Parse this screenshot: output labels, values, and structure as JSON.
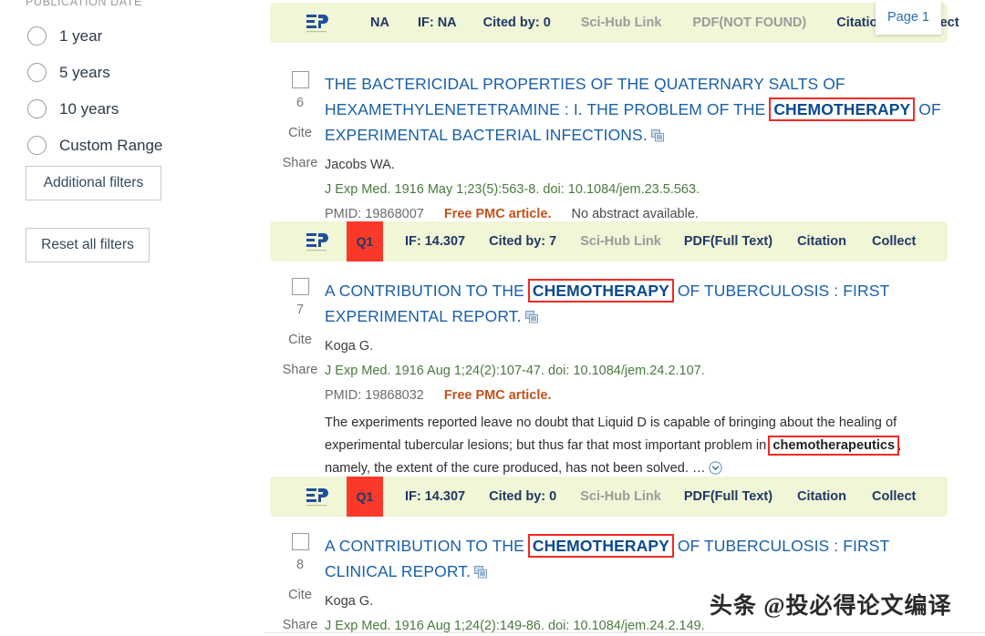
{
  "sidebar": {
    "facet_title": "PUBLICATION DATE",
    "radios": [
      {
        "label": "1 year"
      },
      {
        "label": "5 years"
      },
      {
        "label": "10 years"
      },
      {
        "label": "Custom Range"
      }
    ],
    "additional_filters_label": "Additional filters",
    "reset_filters_label": "Reset all filters"
  },
  "tooltip": {
    "page_label": "Page 1"
  },
  "watermark": {
    "text": "头条 @投必得论文编译"
  },
  "colors": {
    "toolbar_bg": "#f1f6d7",
    "q_badge_bg": "#f93a2a",
    "q_badge_text": "#1b3a63",
    "toolbar_link": "#1f3864",
    "toolbar_link_muted": "#9b9b9b",
    "title_link": "#1a60a8",
    "highlight_outline": "#ee2b24",
    "free_pmc": "#c0531c",
    "citation_green": "#4a7a3f"
  },
  "results": [
    {
      "toolbar": {
        "logo": "ep-logo-icon",
        "quartile": "NA",
        "quartile_is_badge": false,
        "impact_factor": "IF: NA",
        "cited_by": "Cited by: 0",
        "scihub": "Sci-Hub Link",
        "pdf": "PDF(NOT FOUND)",
        "pdf_available": false,
        "citation": "Citation",
        "collect": "Collect"
      },
      "index": "6",
      "cite_label": "Cite",
      "share_label": "Share",
      "title_parts": [
        {
          "text": "THE BACTERICIDAL PROPERTIES OF THE QUATERNARY SALTS OF HEXAMETHYLENETETRAMINE : I. THE PROBLEM OF THE ",
          "highlight": false
        },
        {
          "text": "CHEMOTHERAPY",
          "highlight": true
        },
        {
          "text": " OF EXPERIMENTAL BACTERIAL INFECTIONS.",
          "highlight": false
        }
      ],
      "authors": "Jacobs WA.",
      "citation": "J Exp Med. 1916 May 1;23(5):563-8. doi: 10.1084/jem.23.5.563.",
      "pmid": "PMID: 19868007",
      "free_pmc": "Free PMC article.",
      "no_abstract": "No abstract available.",
      "abstract_parts": []
    },
    {
      "toolbar": {
        "logo": "ep-logo-icon",
        "quartile": "Q1",
        "quartile_is_badge": true,
        "impact_factor": "IF: 14.307",
        "cited_by": "Cited by: 7",
        "scihub": "Sci-Hub Link",
        "pdf": "PDF(Full Text)",
        "pdf_available": true,
        "citation": "Citation",
        "collect": "Collect"
      },
      "index": "7",
      "cite_label": "Cite",
      "share_label": "Share",
      "title_parts": [
        {
          "text": "A CONTRIBUTION TO THE ",
          "highlight": false
        },
        {
          "text": "CHEMOTHERAPY",
          "highlight": true
        },
        {
          "text": " OF TUBERCULOSIS : FIRST EXPERIMENTAL REPORT.",
          "highlight": false
        }
      ],
      "authors": "Koga G.",
      "citation": "J Exp Med. 1916 Aug 1;24(2):107-47. doi: 10.1084/jem.24.2.107.",
      "pmid": "PMID: 19868032",
      "free_pmc": "Free PMC article.",
      "no_abstract": "",
      "abstract_parts": [
        {
          "text": "The experiments reported leave no doubt that Liquid D is capable of bringing about the healing of experimental tubercular lesions; but thus far that most important problem in ",
          "highlight": false
        },
        {
          "text": "chemotherapeutics",
          "highlight": true
        },
        {
          "text": ", namely, the extent of the cure produced, has not been solved. …",
          "highlight": false
        }
      ]
    },
    {
      "toolbar": {
        "logo": "ep-logo-icon",
        "quartile": "Q1",
        "quartile_is_badge": true,
        "impact_factor": "IF: 14.307",
        "cited_by": "Cited by: 0",
        "scihub": "Sci-Hub Link",
        "pdf": "PDF(Full Text)",
        "pdf_available": true,
        "citation": "Citation",
        "collect": "Collect"
      },
      "index": "8",
      "cite_label": "Cite",
      "share_label": "Share",
      "title_parts": [
        {
          "text": "A CONTRIBUTION TO THE ",
          "highlight": false
        },
        {
          "text": "CHEMOTHERAPY",
          "highlight": true
        },
        {
          "text": " OF TUBERCULOSIS : FIRST CLINICAL REPORT.",
          "highlight": false
        }
      ],
      "authors": "Koga G.",
      "citation": "J Exp Med. 1916 Aug 1;24(2):149-86. doi: 10.1084/jem.24.2.149.",
      "pmid": "",
      "free_pmc": "",
      "no_abstract": "",
      "abstract_parts": []
    }
  ]
}
